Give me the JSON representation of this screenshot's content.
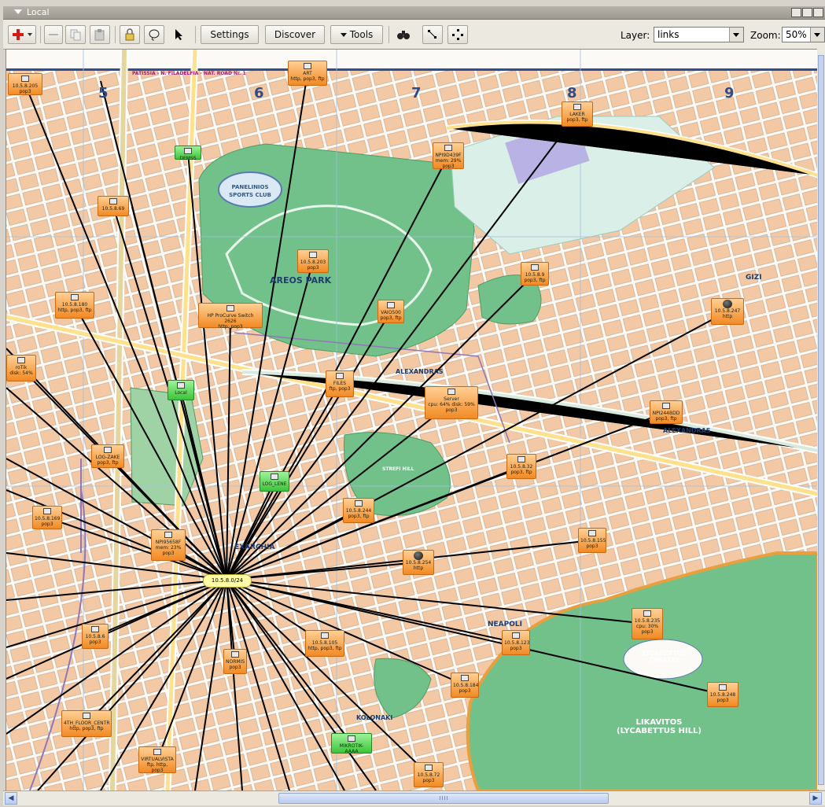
{
  "window": {
    "title": "Local"
  },
  "toolbar": {
    "settings_label": "Settings",
    "discover_label": "Discover",
    "tools_label": "Tools",
    "layer_label": "Layer:",
    "layer_value": "links",
    "zoom_label": "Zoom:",
    "zoom_value": "50%"
  },
  "icons": {
    "add": "plus-icon",
    "remove": "minus-icon",
    "copy": "copy-icon",
    "paste": "paste-icon",
    "lock": "lock-icon",
    "lasso": "lasso-icon",
    "pointer": "pointer-icon",
    "find": "binoculars-icon",
    "layout1": "align-icon",
    "layout2": "distribute-icon"
  },
  "map": {
    "top_road": "PATISSIA - N. FILADELFIA - NAT. ROAD Nr. 1",
    "grid_numbers": [
      "5",
      "6",
      "7",
      "8",
      "9"
    ],
    "places": {
      "club": "PANELINIOS SPORTS CLUB",
      "park": "AREOS PARK",
      "alexandras": "ALEXANDRAS",
      "strefi": "STREFI HILL",
      "neapoli": "NEAPOLI",
      "lyc_theatre": "LYCABETTUS THEATRE",
      "likavitos": "LIKAVITOS (LYCABETTUS HILL)",
      "gizi": "GIZI",
      "exarchia": "EXARCHIA",
      "kolonaki": "KOLONAKI"
    },
    "hub": "10.5.8.0/24",
    "nodes": [
      {
        "id": "n1",
        "lines": [
          "10.5.8.205",
          "pop3"
        ]
      },
      {
        "id": "n2",
        "lines": [
          "ART",
          "http, pop3, ftp"
        ]
      },
      {
        "id": "n3",
        "lines": [
          "LAKER",
          "pop3, ftp"
        ]
      },
      {
        "id": "n4",
        "lines": [
          "DEMSS"
        ]
      },
      {
        "id": "n5",
        "lines": [
          "NPI9D439F",
          "mem: 29%",
          "pop3"
        ]
      },
      {
        "id": "n6",
        "lines": [
          "10.5.8.69"
        ]
      },
      {
        "id": "n7",
        "lines": [
          "10.5.8.203",
          "pop3"
        ]
      },
      {
        "id": "n8",
        "lines": [
          "10.5.8.9",
          "pop3, ftp"
        ]
      },
      {
        "id": "n9",
        "lines": [
          "10.5.8.180",
          "http, pop3, ftp"
        ]
      },
      {
        "id": "n10",
        "lines": [
          "HP ProCurve Switch 2626",
          "http, pop3"
        ]
      },
      {
        "id": "n11",
        "lines": [
          "VAIO500",
          "pop3, ftp"
        ]
      },
      {
        "id": "n12",
        "lines": [
          "10.5.8.247",
          "http"
        ]
      },
      {
        "id": "n13",
        "lines": [
          "roTik",
          "disk: 54%"
        ]
      },
      {
        "id": "n14",
        "lines": [
          "FILES",
          "ftp, pop3"
        ]
      },
      {
        "id": "n15",
        "lines": [
          "Local"
        ]
      },
      {
        "id": "n16",
        "lines": [
          "Server",
          "cpu: 64% disk: 59%",
          "pop3"
        ]
      },
      {
        "id": "n17",
        "lines": [
          "NPI244BDD",
          "pop3, ftp"
        ]
      },
      {
        "id": "n18",
        "lines": [
          "LOG-ZAKE",
          "pop3, ftp"
        ]
      },
      {
        "id": "n19",
        "lines": [
          "10.5.8.32",
          "pop3, ftp"
        ]
      },
      {
        "id": "n20",
        "lines": [
          "LOG_LENE"
        ]
      },
      {
        "id": "n21",
        "lines": [
          "10.5.8.244",
          "pop3, ftp"
        ]
      },
      {
        "id": "n22",
        "lines": [
          "10.5.8.169",
          "pop3"
        ]
      },
      {
        "id": "n23",
        "lines": [
          "NPI95658F",
          "mem: 23%",
          "pop3"
        ]
      },
      {
        "id": "n24",
        "lines": [
          "10.5.8.155",
          "pop3"
        ]
      },
      {
        "id": "n25",
        "lines": [
          "10.5.8.254",
          "http"
        ]
      },
      {
        "id": "n26",
        "lines": [
          "10.5.8.235",
          "cpu: 30%",
          "pop3"
        ]
      },
      {
        "id": "n27",
        "lines": [
          "10.5.8.6",
          "pop3"
        ]
      },
      {
        "id": "n28",
        "lines": [
          "10.5.8.105",
          "http, pop3, ftp"
        ]
      },
      {
        "id": "n29",
        "lines": [
          "10.5.8.123",
          "pop3"
        ]
      },
      {
        "id": "n30",
        "lines": [
          "NORMIS",
          "pop3"
        ]
      },
      {
        "id": "n31",
        "lines": [
          "10.5.8.184",
          "pop3"
        ]
      },
      {
        "id": "n32",
        "lines": [
          "10.5.8.248",
          "pop3"
        ]
      },
      {
        "id": "n33",
        "lines": [
          "4TH_FLOOR_CENTR",
          "http, pop3, ftp"
        ]
      },
      {
        "id": "n34",
        "lines": [
          "MIKROTIK-AAAA"
        ]
      },
      {
        "id": "n35",
        "lines": [
          "VIRTUALVISTA",
          "ftp, http, pop3"
        ]
      },
      {
        "id": "n36",
        "lines": [
          "10.5.8.72",
          "pop3"
        ]
      }
    ]
  }
}
